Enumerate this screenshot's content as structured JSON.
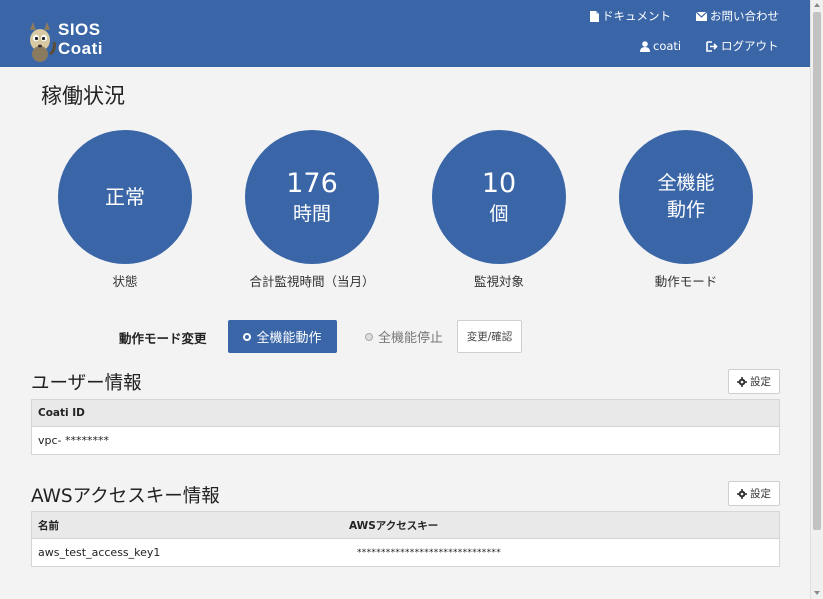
{
  "header": {
    "logo_line1": "SIOS",
    "logo_line2": "Coati",
    "documents_label": "ドキュメント",
    "contact_label": "お問い合わせ",
    "user_label": "coati",
    "logout_label": "ログアウト",
    "brand_color": "#3a66a8"
  },
  "page": {
    "title": "稼働状況"
  },
  "stats": [
    {
      "line1": "正常",
      "line2": "",
      "label": "状態"
    },
    {
      "line1": "176",
      "line2": "時間",
      "label": "合計監視時間（当月）"
    },
    {
      "line1": "10",
      "line2": "個",
      "label": "監視対象"
    },
    {
      "line1": "全機能",
      "line2": "動作",
      "label": "動作モード"
    }
  ],
  "mode": {
    "label": "動作モード変更",
    "option_active": "全機能動作",
    "option_inactive": "全機能停止",
    "confirm_label": "変更/確認"
  },
  "user_info": {
    "title": "ユーザー情報",
    "settings_label": "設定",
    "header": "Coati ID",
    "value": "vpc- ********"
  },
  "aws_info": {
    "title": "AWSアクセスキー情報",
    "settings_label": "設定",
    "columns": [
      "名前",
      "AWSアクセスキー"
    ],
    "rows": [
      {
        "name": "aws_test_access_key1",
        "key": "******************************"
      }
    ]
  },
  "icons": {
    "documents": "file-icon",
    "contact": "envelope-icon",
    "user": "user-icon",
    "logout": "logout-icon",
    "settings": "gear-icon",
    "logo": "coati-mascot-icon"
  }
}
